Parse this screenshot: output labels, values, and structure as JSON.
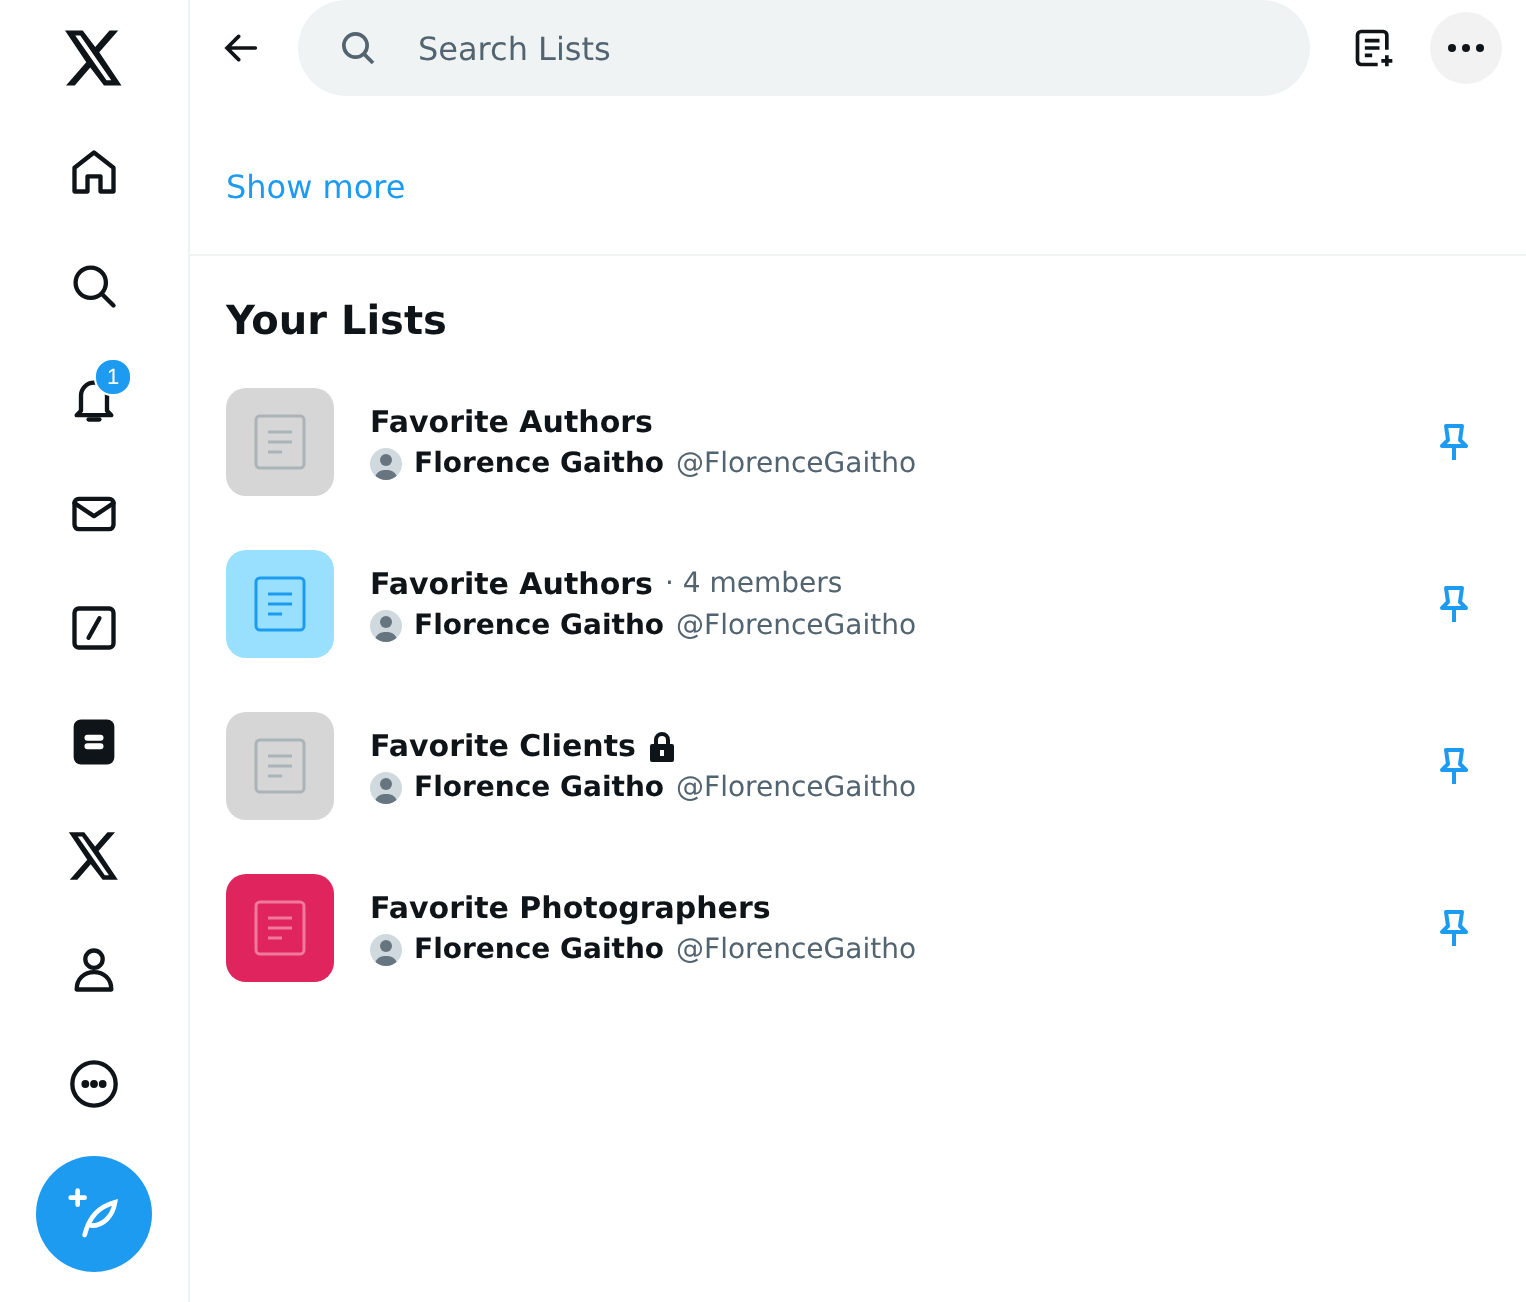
{
  "sidebar": {
    "items": [
      {
        "kind": "logo",
        "selected": false
      },
      {
        "kind": "home",
        "selected": false
      },
      {
        "kind": "explore",
        "selected": false
      },
      {
        "kind": "notifications",
        "selected": false,
        "badge": "1"
      },
      {
        "kind": "messages",
        "selected": false
      },
      {
        "kind": "grok",
        "selected": false
      },
      {
        "kind": "lists",
        "selected": true
      },
      {
        "kind": "premium",
        "selected": false
      },
      {
        "kind": "profile",
        "selected": false
      },
      {
        "kind": "more",
        "selected": false
      }
    ]
  },
  "header": {
    "search": {
      "placeholder": "Search Lists"
    }
  },
  "show_more": "Show more",
  "section_title": "Your Lists",
  "lists": [
    {
      "name": "Favorite Authors",
      "color": "#d6d6d6",
      "owner": "Florence Gaitho",
      "handle": "@FlorenceGaitho",
      "private": false
    },
    {
      "name": "Favorite Authors",
      "members": "· 4 members",
      "color": "#99e0ff",
      "owner": "Florence Gaitho",
      "handle": "@FlorenceGaitho",
      "private": false
    },
    {
      "name": "Favorite Clients",
      "color": "#d6d6d6",
      "owner": "Florence Gaitho",
      "handle": "@FlorenceGaitho",
      "private": true
    },
    {
      "name": "Favorite Photographers",
      "color": "#e0245e",
      "owner": "Florence Gaitho",
      "handle": "@FlorenceGaitho",
      "private": false
    }
  ]
}
